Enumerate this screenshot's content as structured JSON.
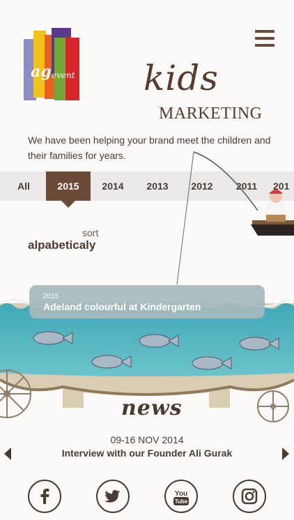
{
  "brand": {
    "logo_text": "agievent"
  },
  "header": {
    "title_script": "kids",
    "title_caps": "MARKETING",
    "intro": "We have been helping your brand meet the children and their families for years."
  },
  "years": {
    "items": [
      "All",
      "2015",
      "2014",
      "2013",
      "2012",
      "2011",
      "201"
    ],
    "active": "2015"
  },
  "sort": {
    "label": "sort",
    "value": "alpabeticaly"
  },
  "featured": {
    "year": "2015",
    "title": "Adeland colourful at Kindergarten"
  },
  "news": {
    "title": "news",
    "date": "09-16 NOV 2014",
    "headline": "Interview with our Founder Ali Gurak"
  },
  "social": [
    "facebook-icon",
    "twitter-icon",
    "youtube-icon",
    "instagram-icon"
  ],
  "colors": {
    "brown": "#6b4a38",
    "water": "#4fb3bf",
    "card": "#a6b9bc"
  }
}
